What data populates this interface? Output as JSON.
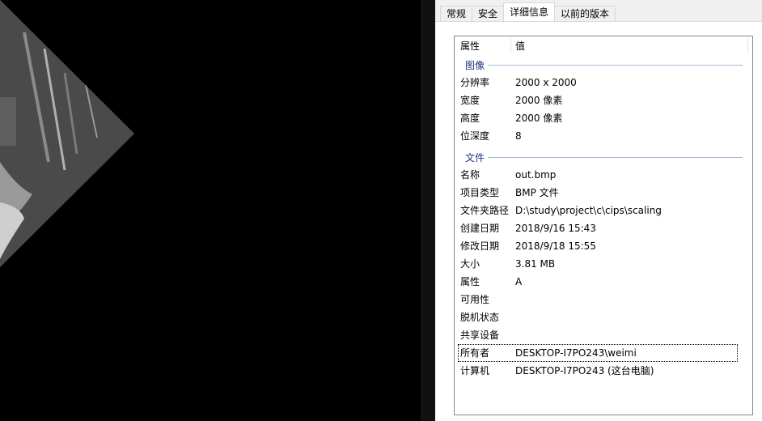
{
  "tabs": [
    "常规",
    "安全",
    "详细信息",
    "以前的版本"
  ],
  "active_tab": "详细信息",
  "list_header": {
    "col_name": "属性",
    "col_value": "值"
  },
  "groups": {
    "image": "图像",
    "file": "文件"
  },
  "image_props": [
    {
      "name": "分辨率",
      "value": "2000 x 2000"
    },
    {
      "name": "宽度",
      "value": "2000 像素"
    },
    {
      "name": "高度",
      "value": "2000 像素"
    },
    {
      "name": "位深度",
      "value": "8"
    }
  ],
  "file_props": [
    {
      "name": "名称",
      "value": "out.bmp"
    },
    {
      "name": "项目类型",
      "value": "BMP 文件"
    },
    {
      "name": "文件夹路径",
      "value": "D:\\study\\project\\c\\cips\\scaling"
    },
    {
      "name": "创建日期",
      "value": "2018/9/16 15:43"
    },
    {
      "name": "修改日期",
      "value": "2018/9/18 15:55"
    },
    {
      "name": "大小",
      "value": "3.81 MB"
    },
    {
      "name": "属性",
      "value": "A"
    },
    {
      "name": "可用性",
      "value": ""
    },
    {
      "name": "脱机状态",
      "value": ""
    },
    {
      "name": "共享设备",
      "value": ""
    },
    {
      "name": "所有者",
      "value": "DESKTOP-I7PO243\\weimi"
    },
    {
      "name": "计算机",
      "value": "DESKTOP-I7PO243 (这台电脑)"
    }
  ],
  "colors": {
    "group_label": "#1e3287",
    "group_line": "#a5b6d2",
    "background": "#000000"
  }
}
